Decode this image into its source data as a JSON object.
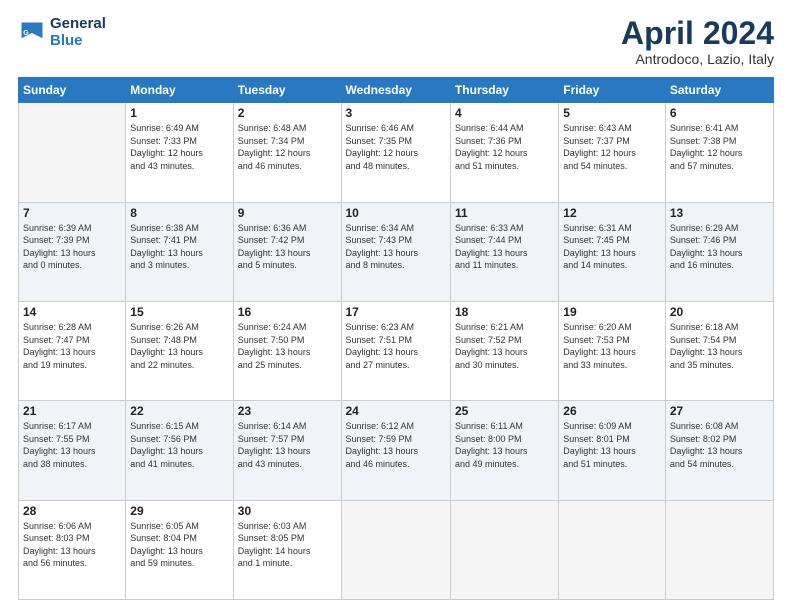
{
  "header": {
    "logo_line1": "General",
    "logo_line2": "Blue",
    "month_title": "April 2024",
    "location": "Antrodoco, Lazio, Italy"
  },
  "weekdays": [
    "Sunday",
    "Monday",
    "Tuesday",
    "Wednesday",
    "Thursday",
    "Friday",
    "Saturday"
  ],
  "weeks": [
    [
      {
        "day": "",
        "info": ""
      },
      {
        "day": "1",
        "info": "Sunrise: 6:49 AM\nSunset: 7:33 PM\nDaylight: 12 hours\nand 43 minutes."
      },
      {
        "day": "2",
        "info": "Sunrise: 6:48 AM\nSunset: 7:34 PM\nDaylight: 12 hours\nand 46 minutes."
      },
      {
        "day": "3",
        "info": "Sunrise: 6:46 AM\nSunset: 7:35 PM\nDaylight: 12 hours\nand 48 minutes."
      },
      {
        "day": "4",
        "info": "Sunrise: 6:44 AM\nSunset: 7:36 PM\nDaylight: 12 hours\nand 51 minutes."
      },
      {
        "day": "5",
        "info": "Sunrise: 6:43 AM\nSunset: 7:37 PM\nDaylight: 12 hours\nand 54 minutes."
      },
      {
        "day": "6",
        "info": "Sunrise: 6:41 AM\nSunset: 7:38 PM\nDaylight: 12 hours\nand 57 minutes."
      }
    ],
    [
      {
        "day": "7",
        "info": "Sunrise: 6:39 AM\nSunset: 7:39 PM\nDaylight: 13 hours\nand 0 minutes."
      },
      {
        "day": "8",
        "info": "Sunrise: 6:38 AM\nSunset: 7:41 PM\nDaylight: 13 hours\nand 3 minutes."
      },
      {
        "day": "9",
        "info": "Sunrise: 6:36 AM\nSunset: 7:42 PM\nDaylight: 13 hours\nand 5 minutes."
      },
      {
        "day": "10",
        "info": "Sunrise: 6:34 AM\nSunset: 7:43 PM\nDaylight: 13 hours\nand 8 minutes."
      },
      {
        "day": "11",
        "info": "Sunrise: 6:33 AM\nSunset: 7:44 PM\nDaylight: 13 hours\nand 11 minutes."
      },
      {
        "day": "12",
        "info": "Sunrise: 6:31 AM\nSunset: 7:45 PM\nDaylight: 13 hours\nand 14 minutes."
      },
      {
        "day": "13",
        "info": "Sunrise: 6:29 AM\nSunset: 7:46 PM\nDaylight: 13 hours\nand 16 minutes."
      }
    ],
    [
      {
        "day": "14",
        "info": "Sunrise: 6:28 AM\nSunset: 7:47 PM\nDaylight: 13 hours\nand 19 minutes."
      },
      {
        "day": "15",
        "info": "Sunrise: 6:26 AM\nSunset: 7:48 PM\nDaylight: 13 hours\nand 22 minutes."
      },
      {
        "day": "16",
        "info": "Sunrise: 6:24 AM\nSunset: 7:50 PM\nDaylight: 13 hours\nand 25 minutes."
      },
      {
        "day": "17",
        "info": "Sunrise: 6:23 AM\nSunset: 7:51 PM\nDaylight: 13 hours\nand 27 minutes."
      },
      {
        "day": "18",
        "info": "Sunrise: 6:21 AM\nSunset: 7:52 PM\nDaylight: 13 hours\nand 30 minutes."
      },
      {
        "day": "19",
        "info": "Sunrise: 6:20 AM\nSunset: 7:53 PM\nDaylight: 13 hours\nand 33 minutes."
      },
      {
        "day": "20",
        "info": "Sunrise: 6:18 AM\nSunset: 7:54 PM\nDaylight: 13 hours\nand 35 minutes."
      }
    ],
    [
      {
        "day": "21",
        "info": "Sunrise: 6:17 AM\nSunset: 7:55 PM\nDaylight: 13 hours\nand 38 minutes."
      },
      {
        "day": "22",
        "info": "Sunrise: 6:15 AM\nSunset: 7:56 PM\nDaylight: 13 hours\nand 41 minutes."
      },
      {
        "day": "23",
        "info": "Sunrise: 6:14 AM\nSunset: 7:57 PM\nDaylight: 13 hours\nand 43 minutes."
      },
      {
        "day": "24",
        "info": "Sunrise: 6:12 AM\nSunset: 7:59 PM\nDaylight: 13 hours\nand 46 minutes."
      },
      {
        "day": "25",
        "info": "Sunrise: 6:11 AM\nSunset: 8:00 PM\nDaylight: 13 hours\nand 49 minutes."
      },
      {
        "day": "26",
        "info": "Sunrise: 6:09 AM\nSunset: 8:01 PM\nDaylight: 13 hours\nand 51 minutes."
      },
      {
        "day": "27",
        "info": "Sunrise: 6:08 AM\nSunset: 8:02 PM\nDaylight: 13 hours\nand 54 minutes."
      }
    ],
    [
      {
        "day": "28",
        "info": "Sunrise: 6:06 AM\nSunset: 8:03 PM\nDaylight: 13 hours\nand 56 minutes."
      },
      {
        "day": "29",
        "info": "Sunrise: 6:05 AM\nSunset: 8:04 PM\nDaylight: 13 hours\nand 59 minutes."
      },
      {
        "day": "30",
        "info": "Sunrise: 6:03 AM\nSunset: 8:05 PM\nDaylight: 14 hours\nand 1 minute."
      },
      {
        "day": "",
        "info": ""
      },
      {
        "day": "",
        "info": ""
      },
      {
        "day": "",
        "info": ""
      },
      {
        "day": "",
        "info": ""
      }
    ]
  ]
}
